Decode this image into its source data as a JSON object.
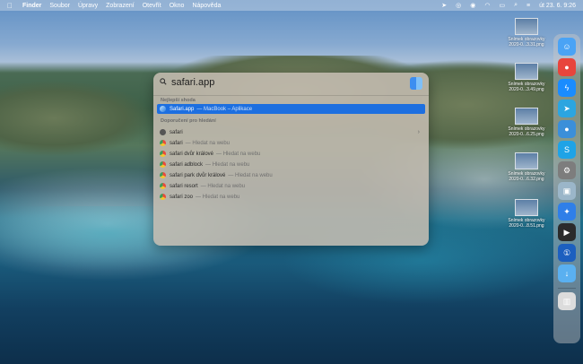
{
  "menubar": {
    "items": [
      "Finder",
      "Soubor",
      "Úpravy",
      "Zobrazení",
      "Otevřít",
      "Okno",
      "Nápověda"
    ],
    "clock": "út 23. 6.  9:26"
  },
  "spotlight": {
    "query": "safari.app",
    "top_hit_section": "Nejlepší shoda",
    "top_hit": {
      "title": "Safari.app",
      "subtitle": "— MacBook – Aplikace"
    },
    "suggestions_section": "Doporučení pro hledání",
    "dictionary_row": {
      "title": "safari"
    },
    "web_rows": [
      {
        "title": "safari",
        "subtitle": "— Hledat na webu"
      },
      {
        "title": "safari dvůr králové",
        "subtitle": "— Hledat na webu"
      },
      {
        "title": "safari adblock",
        "subtitle": "— Hledat na webu"
      },
      {
        "title": "safari park dvůr králové",
        "subtitle": "— Hledat na webu"
      },
      {
        "title": "safari resort",
        "subtitle": "— Hledat na webu"
      },
      {
        "title": "safari zoo",
        "subtitle": "— Hledat na webu"
      }
    ]
  },
  "desktop_files": [
    {
      "line1": "Snímek obrazovky",
      "line2": "2020-0...3.31.png"
    },
    {
      "line1": "Snímek obrazovky",
      "line2": "2020-0...3.49.png"
    },
    {
      "line1": "Snímek obrazovky",
      "line2": "2020-0...6.25.png"
    },
    {
      "line1": "Snímek obrazovky",
      "line2": "2020-0...6.32.png"
    },
    {
      "line1": "Snímek obrazovky",
      "line2": "2020-0...8.51.png"
    }
  ],
  "dock": [
    {
      "name": "finder-icon",
      "color": "#4aa3f5"
    },
    {
      "name": "chrome-icon",
      "color": "#e8453c"
    },
    {
      "name": "messenger-icon",
      "color": "#1a8cff"
    },
    {
      "name": "telegram-icon",
      "color": "#2ca5e0"
    },
    {
      "name": "tweetbot-icon",
      "color": "#3b8fd9"
    },
    {
      "name": "skype-icon",
      "color": "#1fa3e6"
    },
    {
      "name": "system-preferences-icon",
      "color": "#7d7d7d"
    },
    {
      "name": "preview-icon",
      "color": "#9bb6c9"
    },
    {
      "name": "safari-icon",
      "color": "#2f7fe8"
    },
    {
      "name": "final-cut-icon",
      "color": "#2b2b2b"
    },
    {
      "name": "1password-icon",
      "color": "#1c5fbf"
    },
    {
      "name": "downloads-folder-icon",
      "color": "#5ab0f0"
    },
    {
      "name": "trash-icon",
      "color": "#dcdcdc"
    }
  ]
}
